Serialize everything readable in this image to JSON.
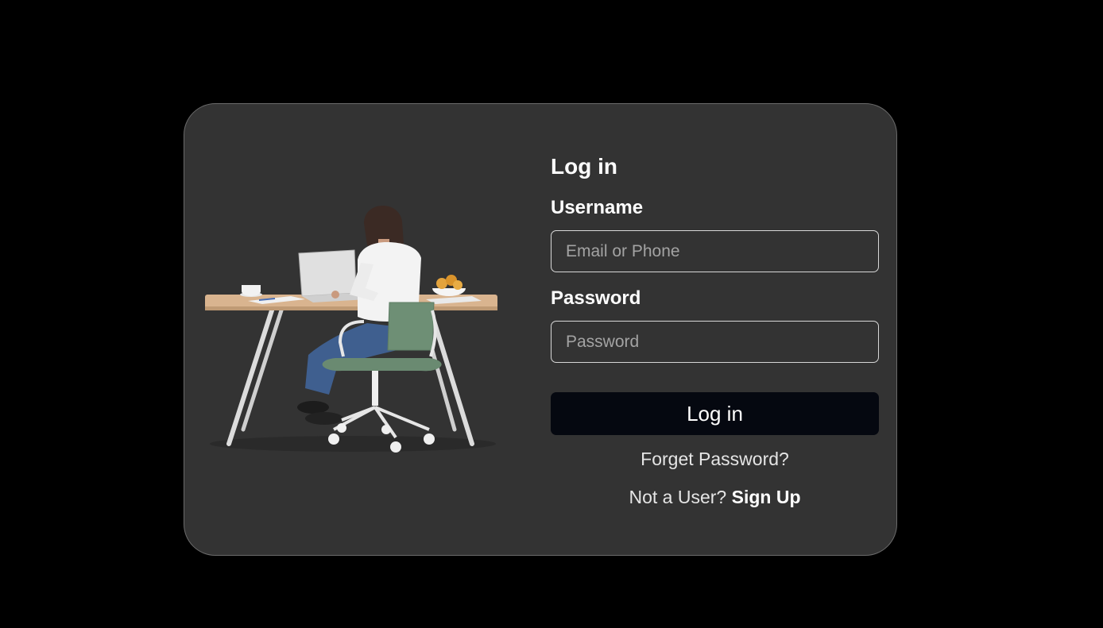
{
  "login": {
    "title": "Log in",
    "username_label": "Username",
    "username_placeholder": "Email or Phone",
    "password_label": "Password",
    "password_placeholder": "Password",
    "submit_label": "Log in",
    "forgot_label": "Forget Password?",
    "signup_prompt": "Not a User?",
    "signup_link": "Sign Up"
  },
  "colors": {
    "page_background": "#000000",
    "card_background": "#333333",
    "button_background": "#050810"
  },
  "illustration": {
    "subject": "person-at-desk-illustration"
  }
}
